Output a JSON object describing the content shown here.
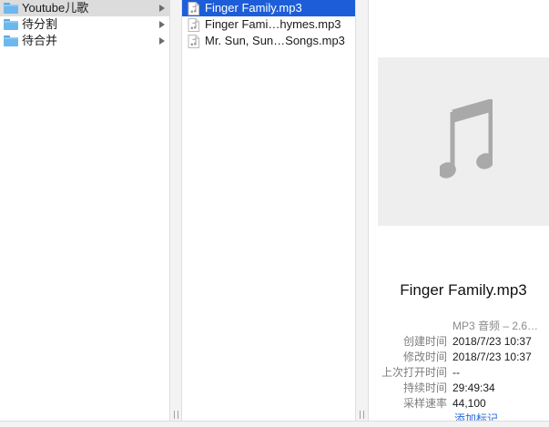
{
  "column1": {
    "items": [
      {
        "label": "Youtube儿歌",
        "selected": true
      },
      {
        "label": "待分割",
        "selected": false
      },
      {
        "label": "待合并",
        "selected": false
      }
    ]
  },
  "column2": {
    "items": [
      {
        "label": "Finger Family.mp3",
        "selected": true
      },
      {
        "label": "Finger Fami…hymes.mp3",
        "selected": false
      },
      {
        "label": "Mr. Sun, Sun…Songs.mp3",
        "selected": false
      }
    ]
  },
  "preview": {
    "title": "Finger Family.mp3",
    "kind": "MP3 音频 – 2.6…",
    "rows": [
      {
        "key": "创建时间",
        "value": "2018/7/23 10:37"
      },
      {
        "key": "修改时间",
        "value": "2018/7/23 10:37"
      },
      {
        "key": "上次打开时间",
        "value": "--"
      },
      {
        "key": "持续时间",
        "value": "29:49:34"
      },
      {
        "key": "采样速率",
        "value": "44,100"
      }
    ],
    "add_tags": "添加标记…"
  },
  "resize_grip": "||",
  "colors": {
    "selection_blue": "#1d5ed8",
    "folder_blue": "#6cb8ee",
    "link_blue": "#2a6ad8"
  }
}
